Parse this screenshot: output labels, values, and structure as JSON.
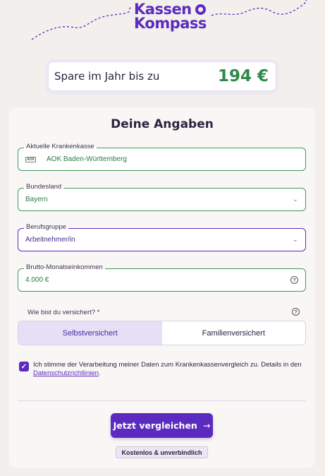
{
  "brand": {
    "line1": "Kassen",
    "line2": "Kompass"
  },
  "savings": {
    "label": "Spare im Jahr bis zu",
    "value": "194 €"
  },
  "form": {
    "title": "Deine Angaben",
    "insurer": {
      "label": "Aktuelle Krankenkasse",
      "value": "AOK Baden-Württemberg",
      "logo_text": "AOK"
    },
    "state": {
      "label": "Bundesland",
      "value": "Bayern"
    },
    "profession": {
      "label": "Berufsgruppe",
      "value": "Arbeitnehmer/in"
    },
    "income": {
      "label": "Brutto-Monatseinkommen",
      "value": "4.000 €"
    },
    "insured_question": "Wie bist du versichert? *",
    "insured_options": [
      "Selbstversichert",
      "Familienversichert"
    ],
    "insured_selected": "Selbstversichert",
    "consent": {
      "checked": true,
      "text": "Ich stimme der Verarbeitung meiner Daten zum Krankenkassenvergleich zu. Details in den ",
      "link": "Datenschutzrichtlinien",
      "suffix": "."
    },
    "cta": {
      "label": "Jetzt vergleichen",
      "arrow": "→"
    },
    "badge": "Kostenlos & unverbindlich"
  },
  "colors": {
    "brand": "#5b2bbf",
    "savings_green": "#2f8a4a",
    "field_border_green": "#3d9a5a",
    "background": "#f3efec"
  }
}
